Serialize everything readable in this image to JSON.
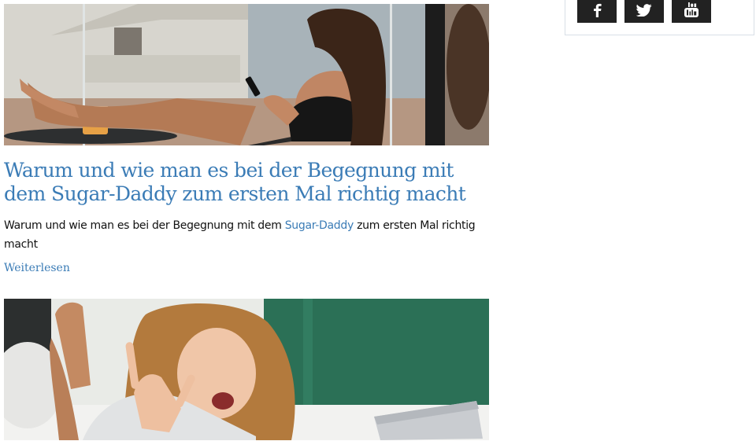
{
  "posts": [
    {
      "title": "Warum und wie man es bei der Begegnung mit dem Sugar-Daddy zum ersten Mal richtig macht",
      "excerpt_before": "Warum und wie man es bei der Begegnung mit dem ",
      "excerpt_link": "Sugar-Daddy",
      "excerpt_after": " zum ersten Mal richtig macht",
      "read_more": "Weiterlesen",
      "image": "woman-on-balcony-with-phone-photo"
    },
    {
      "image": "excited-woman-with-laptop-photo"
    }
  ],
  "sidebar": {
    "social": [
      {
        "icon": "facebook-icon"
      },
      {
        "icon": "twitter-icon"
      },
      {
        "icon": "youtube-icon"
      }
    ]
  },
  "colors": {
    "accent": "#3b7cb6",
    "social_button": "#222222",
    "widget_border": "#d8dfe6"
  }
}
